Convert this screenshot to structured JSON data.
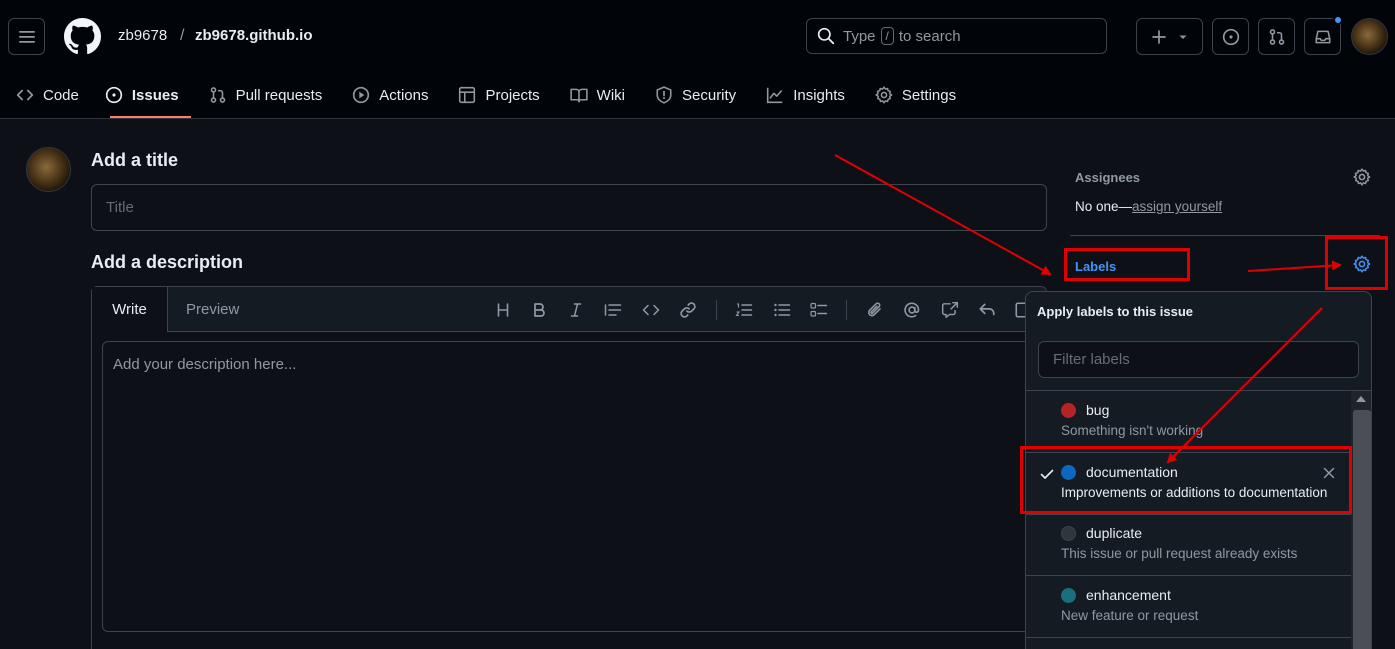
{
  "header": {
    "repo_owner": "zb9678",
    "repo_separator": "/",
    "repo_name": "zb9678.github.io",
    "search": {
      "prefix": "Type",
      "key": "/",
      "suffix": "to search"
    }
  },
  "nav": [
    {
      "label": "Code",
      "icon": "code-icon"
    },
    {
      "label": "Issues",
      "icon": "issue-opened-icon",
      "active": true
    },
    {
      "label": "Pull requests",
      "icon": "git-pull-request-icon"
    },
    {
      "label": "Actions",
      "icon": "play-icon"
    },
    {
      "label": "Projects",
      "icon": "table-icon"
    },
    {
      "label": "Wiki",
      "icon": "book-icon"
    },
    {
      "label": "Security",
      "icon": "shield-icon"
    },
    {
      "label": "Insights",
      "icon": "graph-icon"
    },
    {
      "label": "Settings",
      "icon": "gear-icon"
    }
  ],
  "issue": {
    "title_heading": "Add a title",
    "title_placeholder": "Title",
    "description_heading": "Add a description",
    "tab_write": "Write",
    "tab_preview": "Preview",
    "description_placeholder": "Add your description here..."
  },
  "sidebar": {
    "assignees_label": "Assignees",
    "assignees_none": "No one—",
    "assign_yourself": "assign yourself",
    "labels_label": "Labels"
  },
  "labels_dropdown": {
    "header": "Apply labels to this issue",
    "filter_placeholder": "Filter labels",
    "items": [
      {
        "name": "bug",
        "description": "Something isn't working",
        "color": "#b62324",
        "selected": false
      },
      {
        "name": "documentation",
        "description": "Improvements or additions to documentation",
        "color": "#0d67bf",
        "selected": true
      },
      {
        "name": "duplicate",
        "description": "This issue or pull request already exists",
        "color": "#30363d",
        "selected": false
      },
      {
        "name": "enhancement",
        "description": "New feature or request",
        "color": "#1b6e7d",
        "selected": false
      }
    ]
  },
  "colors": {
    "accent_link": "#4493f8",
    "annotation_red": "#e00000",
    "active_tab_underline": "#f78166"
  }
}
